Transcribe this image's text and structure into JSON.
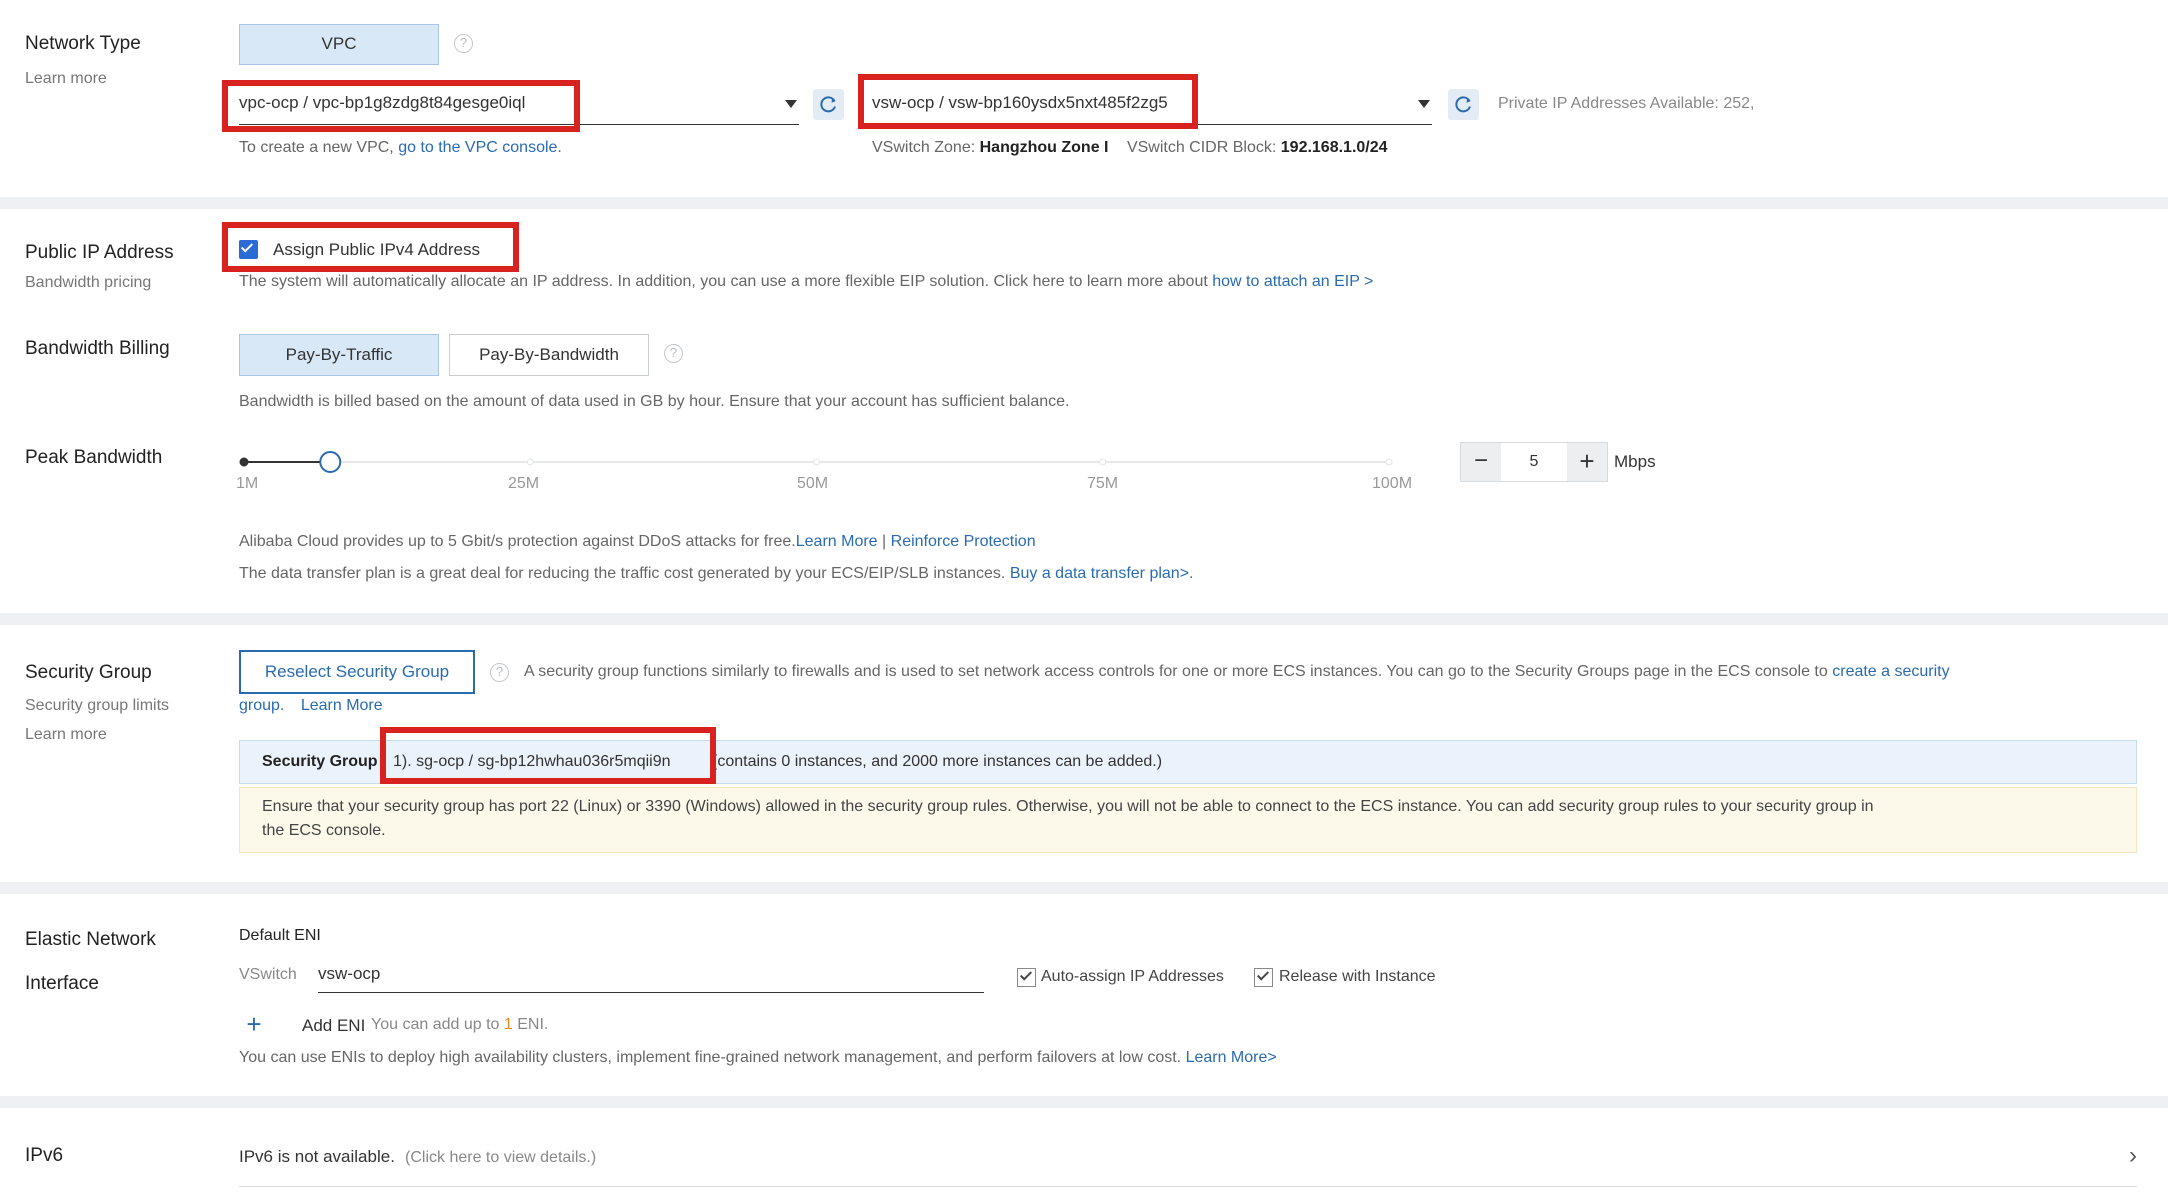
{
  "network": {
    "label": "Network Type",
    "learn_more": "Learn more",
    "vpc_button": "VPC",
    "vpc_select": "vpc-ocp / vpc-bp1g8zdg8t84gesge0iql",
    "vswitch_select": "vsw-ocp / vsw-bp160ysdx5nxt485f2zg5",
    "private_ip_text": "Private IP Addresses Available: 252,",
    "create_vpc_prefix": "To create a new VPC,",
    "create_vpc_link": "go to the VPC console",
    "create_vpc_suffix": ".",
    "zone_label": "VSwitch Zone:",
    "zone_value": "Hangzhou Zone I",
    "cidr_label": "VSwitch CIDR Block:",
    "cidr_value": "192.168.1.0/24"
  },
  "public_ip": {
    "label": "Public IP Address",
    "bandwidth_pricing": "Bandwidth pricing",
    "checkbox_label": "Assign Public IPv4 Address",
    "checked": true,
    "desc": "The system will automatically allocate an IP address. In addition, you can use a more flexible EIP solution. Click here to learn more about",
    "desc_link": "how to attach an EIP >"
  },
  "billing": {
    "label": "Bandwidth Billing",
    "option_traffic": "Pay-By-Traffic",
    "option_bandwidth": "Pay-By-Bandwidth",
    "selected": "Pay-By-Traffic",
    "note": "Bandwidth is billed based on the amount of data used in GB by hour. Ensure that your account has sufficient balance."
  },
  "peak": {
    "label": "Peak Bandwidth",
    "ticks": [
      "1M",
      "25M",
      "50M",
      "75M",
      "100M"
    ],
    "slider_value": 5,
    "slider_min": 1,
    "slider_max": 100,
    "stepper_value": "5",
    "minus": "−",
    "plus": "+",
    "unit": "Mbps",
    "ddos_text": "Alibaba Cloud provides up to 5 Gbit/s protection against DDoS attacks for free.",
    "ddos_link1": "Learn More",
    "ddos_sep": "|",
    "ddos_link2": "Reinforce Protection",
    "plan_text": "The data transfer plan is a great deal for reducing the traffic cost generated by your ECS/EIP/SLB instances.",
    "plan_link": "Buy a data transfer plan>."
  },
  "security": {
    "label": "Security Group",
    "limits": "Security group limits",
    "learn_more": "Learn more",
    "reselect_button": "Reselect Security Group",
    "desc": "A security group functions similarly to firewalls and is used to set network access controls for one or more ECS instances. You can go to the Security Groups page in the ECS console to",
    "desc_link1": "create a security",
    "desc_link2": "group.",
    "desc_learn_more": "Learn More",
    "group_label": "Security Group",
    "group_value": "1). sg-ocp / sg-bp12hwhau036r5mqii9n",
    "group_suffix": "(contains 0 instances, and 2000 more instances can be added.)",
    "warning_line1": "Ensure that your security group has port 22 (Linux) or 3390 (Windows) allowed in the security group rules. Otherwise, you will not be able to connect to the ECS instance. You can add security group rules to your security group in",
    "warning_line2": "the ECS console."
  },
  "eni": {
    "label_line1": "Elastic Network",
    "label_line2": "Interface",
    "default_eni": "Default ENI",
    "vswitch_label": "VSwitch",
    "vswitch_value": "vsw-ocp",
    "auto_assign": "Auto-assign IP Addresses",
    "release": "Release with Instance",
    "add_icon": "+",
    "add_eni": "Add ENI",
    "add_note_prefix": "You can add up to",
    "add_note_count": "1",
    "add_note_suffix": "ENI.",
    "footer": "You can use ENIs to deploy high availability clusters, implement fine-grained network management, and perform failovers at low cost.",
    "footer_link": "Learn More>"
  },
  "ipv6": {
    "label": "IPv6",
    "status": "IPv6 is not available.",
    "details": "(Click here to view details.)",
    "chevron": "›"
  },
  "colors": {
    "accent_blue": "#2a6bb0",
    "highlight_red": "#d7221f",
    "selected_bg": "#d9e8f7"
  }
}
